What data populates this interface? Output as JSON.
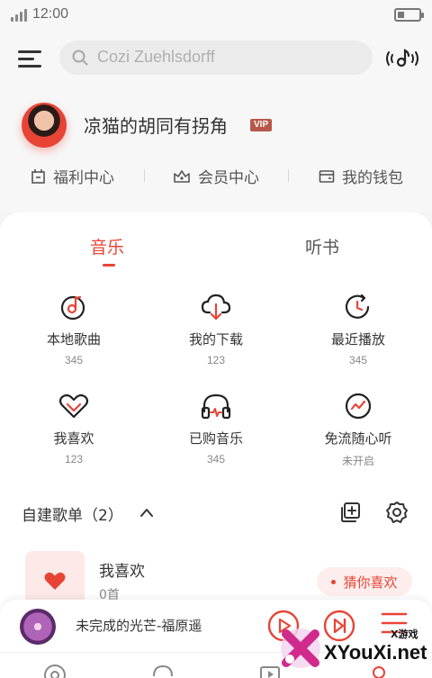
{
  "status_bar": {
    "time": "12:00",
    "battery_level": 0.3
  },
  "header": {
    "search_placeholder": "Cozi Zuehlsdorff"
  },
  "profile": {
    "username": "凉猫的胡同有拐角",
    "vip_badge": "VIP"
  },
  "quick_links": [
    {
      "label": "福利中心",
      "icon": "gift-box-icon"
    },
    {
      "label": "会员中心",
      "icon": "crown-icon"
    },
    {
      "label": "我的钱包",
      "icon": "wallet-icon"
    }
  ],
  "tabs": [
    {
      "label": "音乐",
      "active": true
    },
    {
      "label": "听书",
      "active": false
    }
  ],
  "grid": [
    {
      "label": "本地歌曲",
      "sub": "345",
      "icon": "local-music-icon"
    },
    {
      "label": "我的下载",
      "sub": "123",
      "icon": "cloud-download-icon"
    },
    {
      "label": "最近播放",
      "sub": "345",
      "icon": "recent-play-icon"
    },
    {
      "label": "我喜欢",
      "sub": "123",
      "icon": "heart-icon"
    },
    {
      "label": "已购音乐",
      "sub": "345",
      "icon": "headphones-icon"
    },
    {
      "label": "免流随心听",
      "sub": "未开启",
      "icon": "trend-icon"
    }
  ],
  "playlists": {
    "title": "自建歌单（2）",
    "items": [
      {
        "name": "我喜欢",
        "count": "0首"
      }
    ],
    "guess_button": "猜你喜欢"
  },
  "player": {
    "song_title": "未完成的光芒-福原遥"
  },
  "watermark": {
    "text": "XYouXi.net",
    "small": "X游戏"
  },
  "colors": {
    "accent": "#e84436",
    "background": "#f4f4f4",
    "card": "#ffffff"
  }
}
